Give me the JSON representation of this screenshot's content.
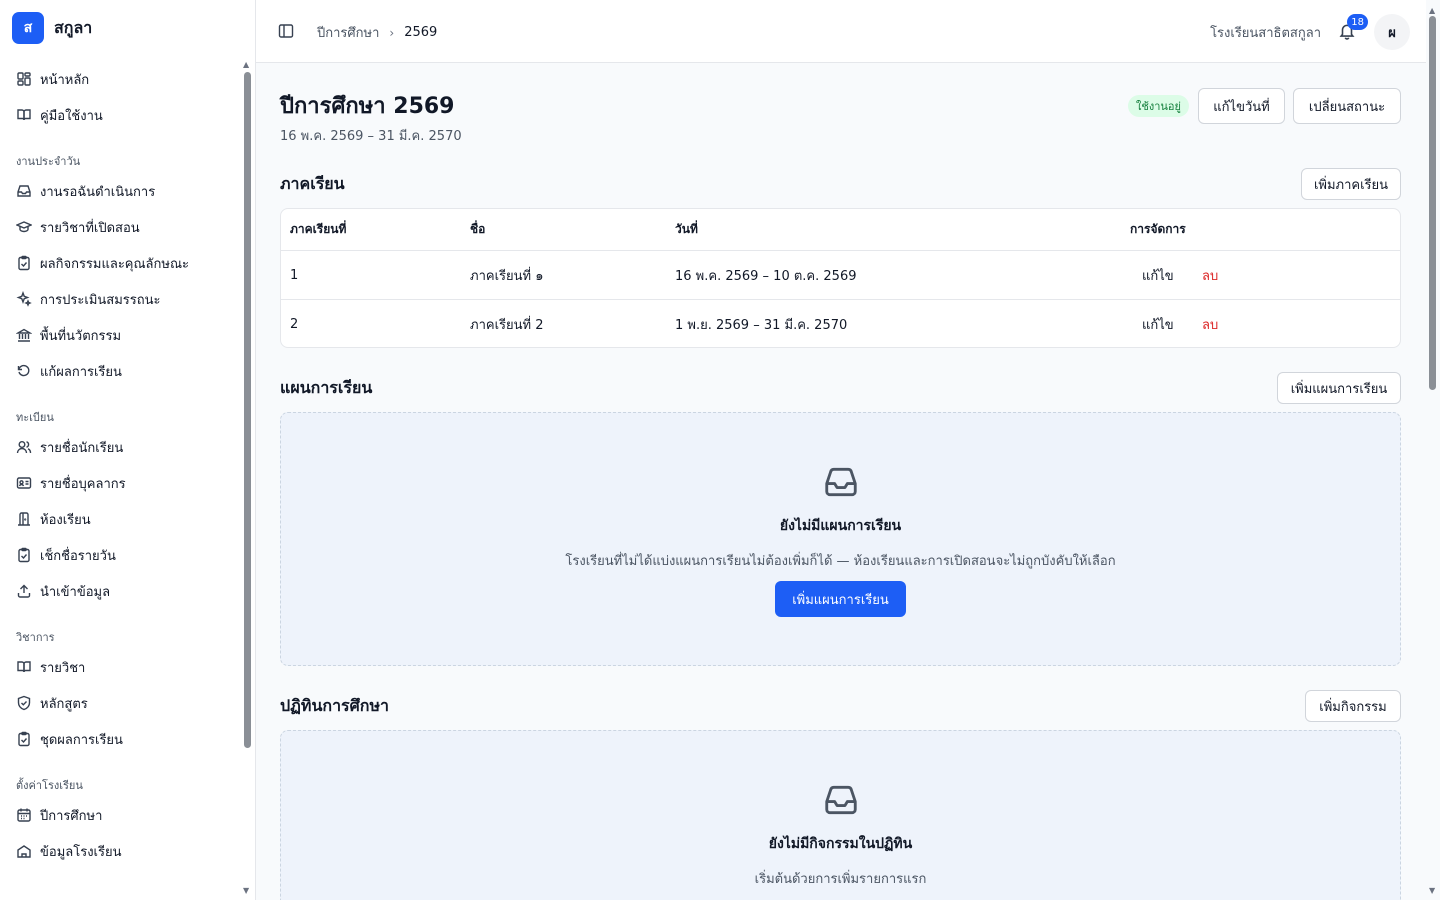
{
  "brand": {
    "logo_letter": "ส",
    "name": "สกูลา"
  },
  "sidebar": {
    "top_items": [
      {
        "label": "หน้าหลัก",
        "icon": "dashboard-icon"
      },
      {
        "label": "คู่มือใช้งาน",
        "icon": "book-open-icon"
      }
    ],
    "sections": [
      {
        "title": "งานประจำวัน",
        "items": [
          {
            "label": "งานรอฉันดำเนินการ",
            "icon": "inbox-icon"
          },
          {
            "label": "รายวิชาที่เปิดสอน",
            "icon": "graduation-cap-icon"
          },
          {
            "label": "ผลกิจกรรมและคุณลักษณะ",
            "icon": "clipboard-check-icon"
          },
          {
            "label": "การประเมินสมรรถนะ",
            "icon": "sparkles-icon"
          },
          {
            "label": "พื้นที่นวัตกรรม",
            "icon": "landmark-icon"
          },
          {
            "label": "แก้ผลการเรียน",
            "icon": "rotate-ccw-icon"
          }
        ]
      },
      {
        "title": "ทะเบียน",
        "items": [
          {
            "label": "รายชื่อนักเรียน",
            "icon": "users-icon"
          },
          {
            "label": "รายชื่อบุคลากร",
            "icon": "id-card-icon"
          },
          {
            "label": "ห้องเรียน",
            "icon": "door-icon"
          },
          {
            "label": "เช็กชื่อรายวัน",
            "icon": "clipboard-check-icon"
          },
          {
            "label": "นำเข้าข้อมูล",
            "icon": "upload-icon"
          }
        ]
      },
      {
        "title": "วิชาการ",
        "items": [
          {
            "label": "รายวิชา",
            "icon": "book-open-icon"
          },
          {
            "label": "หลักสูตร",
            "icon": "shield-check-icon"
          },
          {
            "label": "ชุดผลการเรียน",
            "icon": "clipboard-check-icon"
          }
        ]
      },
      {
        "title": "ตั้งค่าโรงเรียน",
        "items": [
          {
            "label": "ปีการศึกษา",
            "icon": "calendar-icon"
          },
          {
            "label": "ข้อมูลโรงเรียน",
            "icon": "school-icon"
          }
        ]
      }
    ]
  },
  "header": {
    "breadcrumb": [
      "ปีการศึกษา",
      "2569"
    ],
    "school_name": "โรงเรียนสาธิตสกูลา",
    "notification_count": "18",
    "avatar_initial": "ผ"
  },
  "page": {
    "title": "ปีการศึกษา 2569",
    "date_range": "16 พ.ค. 2569 – 31 มี.ค. 2570",
    "status": "ใช้งานอยู่",
    "edit_dates_label": "แก้ไขวันที่",
    "change_status_label": "เปลี่ยนสถานะ"
  },
  "terms": {
    "title": "ภาคเรียน",
    "add_label": "เพิ่มภาคเรียน",
    "columns": [
      "ภาคเรียนที่",
      "ชื่อ",
      "วันที่",
      "การจัดการ"
    ],
    "rows": [
      {
        "number": "1",
        "name": "ภาคเรียนที่ ๑",
        "dates": "16 พ.ค. 2569 – 10 ต.ค. 2569",
        "edit": "แก้ไข",
        "delete": "ลบ"
      },
      {
        "number": "2",
        "name": "ภาคเรียนที่ 2",
        "dates": "1 พ.ย. 2569 – 31 มี.ค. 2570",
        "edit": "แก้ไข",
        "delete": "ลบ"
      }
    ]
  },
  "plans": {
    "title": "แผนการเรียน",
    "add_label": "เพิ่มแผนการเรียน",
    "empty_title": "ยังไม่มีแผนการเรียน",
    "empty_desc": "โรงเรียนที่ไม่ได้แบ่งแผนการเรียนไม่ต้องเพิ่มก็ได้ — ห้องเรียนและการเปิดสอนจะไม่ถูกบังคับให้เลือก",
    "empty_button": "เพิ่มแผนการเรียน"
  },
  "calendar": {
    "title": "ปฏิทินการศึกษา",
    "add_label": "เพิ่มกิจกรรม",
    "empty_title": "ยังไม่มีกิจกรรมในปฏิทิน",
    "empty_desc": "เริ่มต้นด้วยการเพิ่มรายการแรก"
  }
}
